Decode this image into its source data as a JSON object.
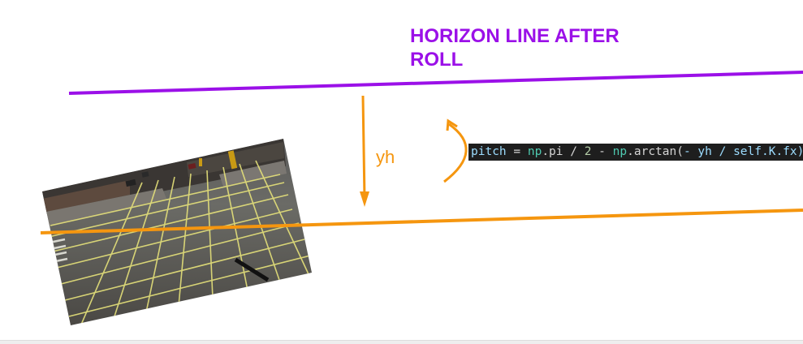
{
  "title": "HORIZON LINE AFTER ROLL",
  "yh_label": "yh",
  "code": {
    "full": "pitch = np.pi / 2 - np.arctan(- yh / self.K.fx)",
    "tokens": [
      {
        "t": "pitch",
        "c": "var"
      },
      {
        "t": " = ",
        "c": "op"
      },
      {
        "t": "np",
        "c": "mod"
      },
      {
        "t": ".pi / ",
        "c": "op"
      },
      {
        "t": "2",
        "c": "num"
      },
      {
        "t": " - ",
        "c": "op"
      },
      {
        "t": "np",
        "c": "mod"
      },
      {
        "t": ".arctan(",
        "c": "op"
      },
      {
        "t": "- yh / self.K.fx)",
        "c": "var"
      }
    ]
  },
  "colors": {
    "purple": "#9b10e8",
    "orange": "#f5960f",
    "code_bg": "#1e1e1e"
  },
  "image_content": "road intersection photo with yellow grid overlay"
}
